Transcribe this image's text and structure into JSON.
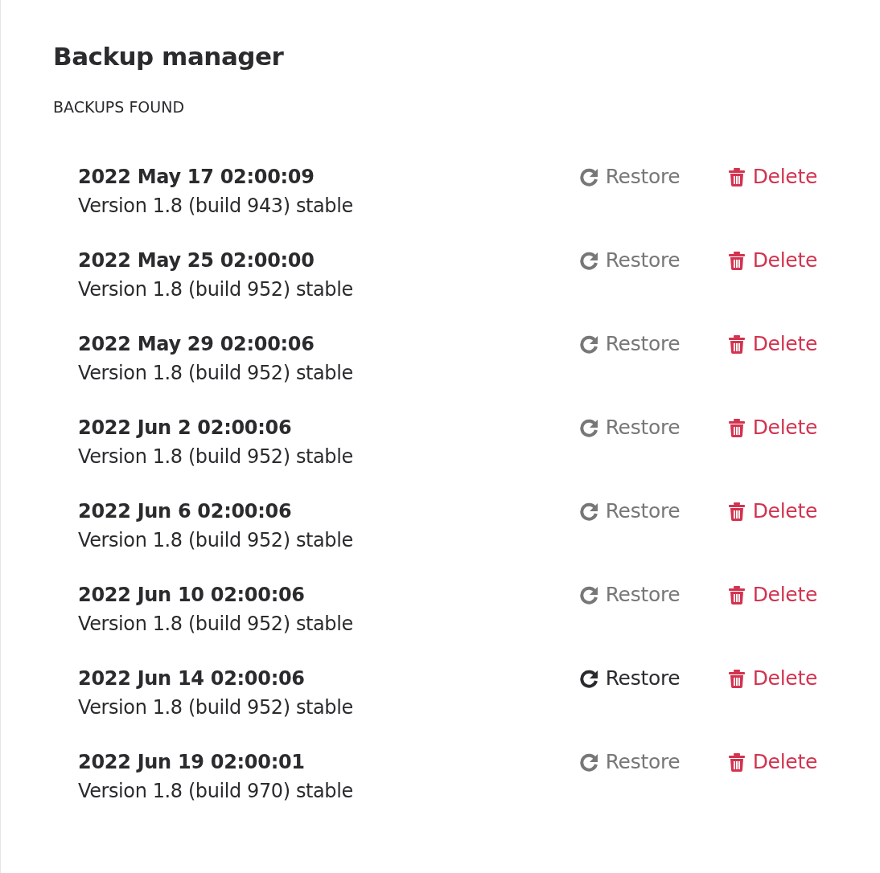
{
  "title": "Backup manager",
  "section_label": "BACKUPS FOUND",
  "backups": [
    {
      "date": "2022 May 17 02:00:09",
      "version": "Version 1.8 (build 943) stable",
      "restore": {
        "label": "Restore",
        "hovered": false
      },
      "delete": {
        "label": "Delete"
      }
    },
    {
      "date": "2022 May 25 02:00:00",
      "version": "Version 1.8 (build 952) stable",
      "restore": {
        "label": "Restore",
        "hovered": false
      },
      "delete": {
        "label": "Delete"
      }
    },
    {
      "date": "2022 May 29 02:00:06",
      "version": "Version 1.8 (build 952) stable",
      "restore": {
        "label": "Restore",
        "hovered": false
      },
      "delete": {
        "label": "Delete"
      }
    },
    {
      "date": "2022 Jun 2 02:00:06",
      "version": "Version 1.8 (build 952) stable",
      "restore": {
        "label": "Restore",
        "hovered": false
      },
      "delete": {
        "label": "Delete"
      }
    },
    {
      "date": "2022 Jun 6 02:00:06",
      "version": "Version 1.8 (build 952) stable",
      "restore": {
        "label": "Restore",
        "hovered": false
      },
      "delete": {
        "label": "Delete"
      }
    },
    {
      "date": "2022 Jun 10 02:00:06",
      "version": "Version 1.8 (build 952) stable",
      "restore": {
        "label": "Restore",
        "hovered": false
      },
      "delete": {
        "label": "Delete"
      }
    },
    {
      "date": "2022 Jun 14 02:00:06",
      "version": "Version 1.8 (build 952) stable",
      "restore": {
        "label": "Restore",
        "hovered": true
      },
      "delete": {
        "label": "Delete"
      }
    },
    {
      "date": "2022 Jun 19 02:00:01",
      "version": "Version 1.8 (build 970) stable",
      "restore": {
        "label": "Restore",
        "hovered": false
      },
      "delete": {
        "label": "Delete"
      }
    }
  ]
}
